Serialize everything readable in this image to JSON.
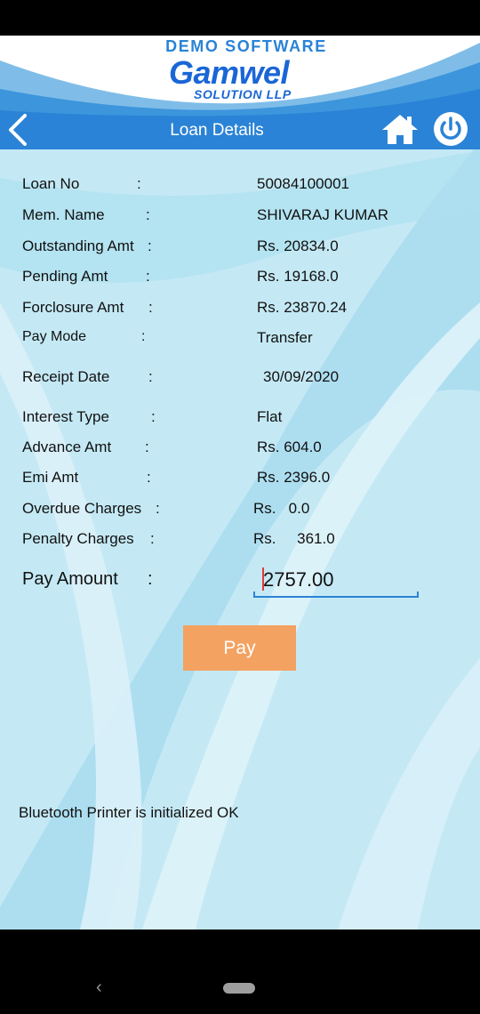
{
  "header": {
    "demo_text": "DEMO SOFTWARE",
    "logo_main": "Gamwel",
    "logo_sub": "SOLUTION LLP",
    "title": "Loan Details",
    "back_icon": "back-chevron-icon",
    "home_icon": "home-icon",
    "power_icon": "power-icon"
  },
  "details": [
    {
      "label": "Loan No",
      "value": "50084100001"
    },
    {
      "label": "Mem. Name",
      "value": "SHIVARAJ KUMAR"
    },
    {
      "label": "Outstanding Amt",
      "value": "Rs. 20834.0"
    },
    {
      "label": "Pending Amt",
      "value": "Rs. 19168.0"
    },
    {
      "label": "Forclosure Amt",
      "value": "Rs. 23870.24"
    },
    {
      "label": "Pay Mode",
      "value": "Transfer"
    },
    {
      "label": "Receipt Date",
      "value": "30/09/2020"
    },
    {
      "label": "Interest Type",
      "value": "Flat"
    },
    {
      "label": "Advance Amt",
      "value": "Rs. 604.0"
    },
    {
      "label": "Emi Amt",
      "value": "Rs. 2396.0"
    },
    {
      "label": "Overdue Charges",
      "value": "Rs.   0.0"
    },
    {
      "label": "Penalty Charges",
      "value": "Rs.     361.0"
    }
  ],
  "separator": ":",
  "pay_amount": {
    "label": "Pay Amount",
    "value": "2757.00"
  },
  "pay_button": "Pay",
  "status_message": "Bluetooth Printer is initialized OK",
  "colors": {
    "header_blue": "#2a83d6",
    "logo_blue": "#1a66d6",
    "pay_button": "#f4a261",
    "background": "#bfe7f3"
  },
  "nav": {
    "back_glyph": "‹",
    "back_icon": "nav-back-icon",
    "home_icon": "nav-home-pill-icon"
  }
}
